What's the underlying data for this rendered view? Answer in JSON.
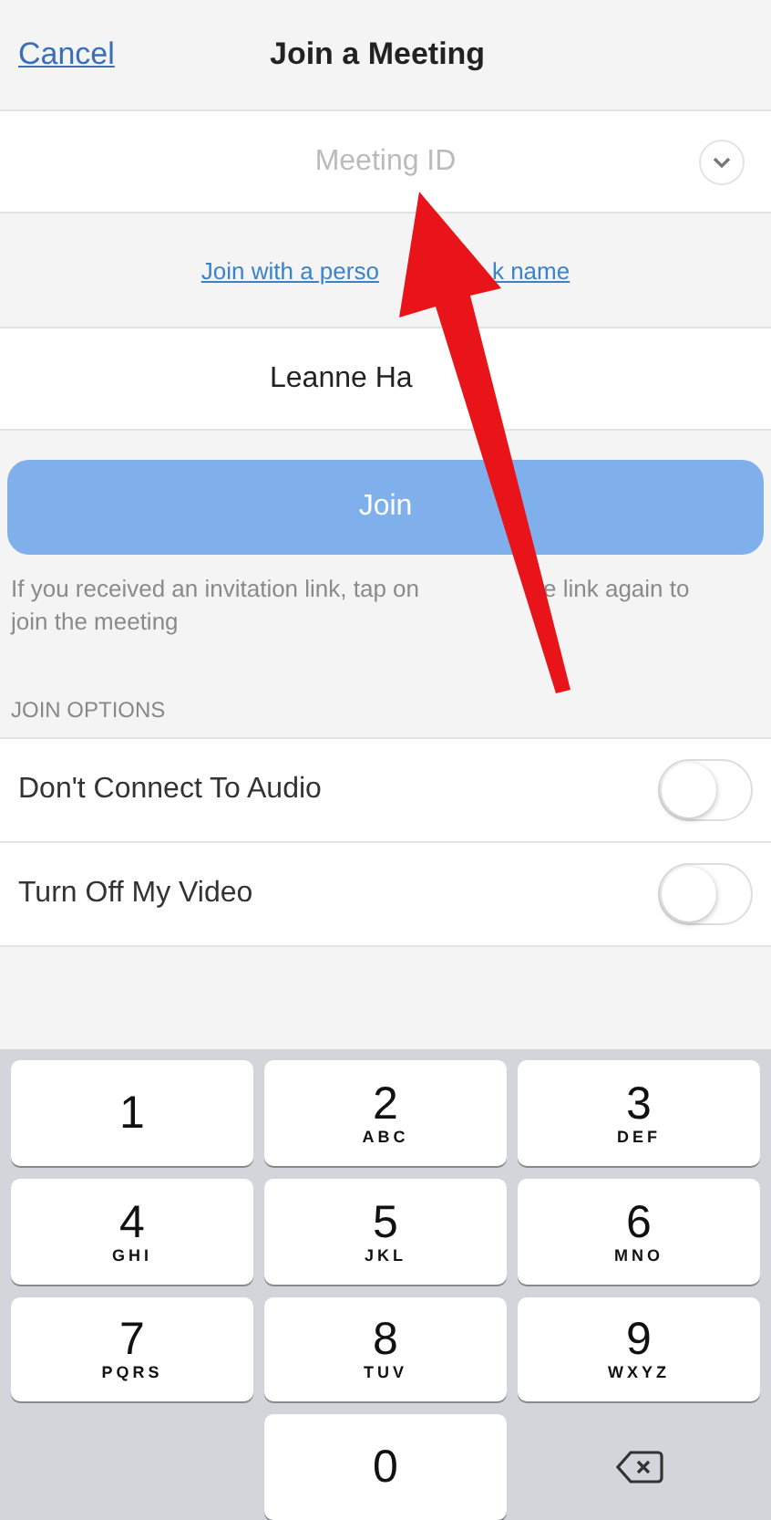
{
  "header": {
    "cancel": "Cancel",
    "title": "Join a Meeting"
  },
  "meeting_id": {
    "placeholder": "Meeting ID"
  },
  "personal_link": {
    "text_parts": [
      "Join with a perso",
      "k name"
    ]
  },
  "name_field": {
    "value": "Leanne Ha"
  },
  "join_button": {
    "label": "Join",
    "disabled": true
  },
  "help_text": {
    "line_1_parts": [
      "If you received an invitation link, tap on",
      "e link again to"
    ],
    "line_2": "join the meeting"
  },
  "join_options": {
    "heading": "JOIN OPTIONS",
    "items": [
      {
        "label": "Don't Connect To Audio",
        "on": false
      },
      {
        "label": "Turn Off My Video",
        "on": false
      }
    ]
  },
  "keypad": [
    {
      "kind": "digit",
      "digit": "1"
    },
    {
      "kind": "digit",
      "digit": "2",
      "letters": "ABC"
    },
    {
      "kind": "digit",
      "digit": "3",
      "letters": "DEF"
    },
    {
      "kind": "digit",
      "digit": "4",
      "letters": "GHI"
    },
    {
      "kind": "digit",
      "digit": "5",
      "letters": "JKL"
    },
    {
      "kind": "digit",
      "digit": "6",
      "letters": "MNO"
    },
    {
      "kind": "digit",
      "digit": "7",
      "letters": "PQRS"
    },
    {
      "kind": "digit",
      "digit": "8",
      "letters": "TUV"
    },
    {
      "kind": "digit",
      "digit": "9",
      "letters": "WXYZ"
    },
    {
      "kind": "spacer"
    },
    {
      "kind": "digit",
      "digit": "0"
    },
    {
      "kind": "delete"
    }
  ]
}
